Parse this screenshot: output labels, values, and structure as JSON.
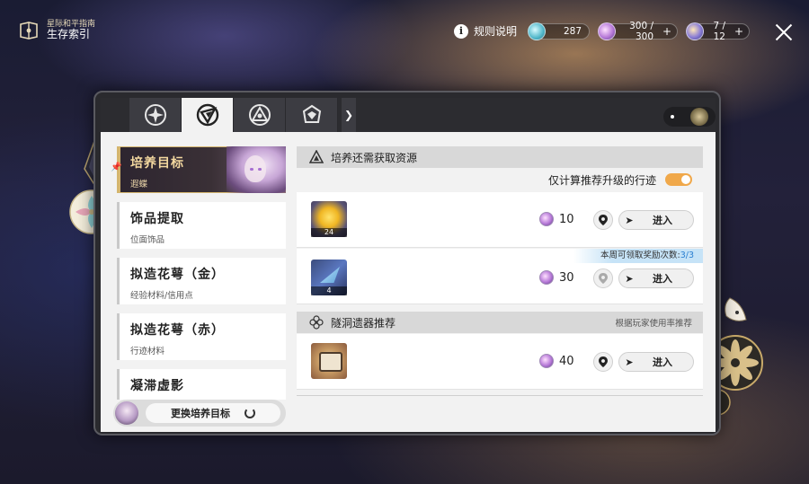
{
  "header": {
    "subtitle": "星际和平指南",
    "title": "生存索引",
    "rules_label": "规则说明",
    "resources": [
      {
        "icon": "crystal-icon",
        "value": "287"
      },
      {
        "icon": "trailblaze-power-icon",
        "value": "300 / 300"
      },
      {
        "icon": "fuel-icon",
        "value": "7 / 12"
      }
    ]
  },
  "tabs": [
    {
      "icon": "star-emblem-tab-icon",
      "active": false
    },
    {
      "icon": "compass-tab-icon",
      "active": true
    },
    {
      "icon": "triangle-emblem-tab-icon",
      "active": false
    },
    {
      "icon": "crown-emblem-tab-icon",
      "active": false
    }
  ],
  "sidebar": {
    "items": [
      {
        "title": "培养目标",
        "sub": "遐蝶",
        "active": true
      },
      {
        "title": "饰品提取",
        "sub": "位面饰品"
      },
      {
        "title": "拟造花萼（金）",
        "sub": "经验材料/信用点"
      },
      {
        "title": "拟造花萼（赤）",
        "sub": "行迹材料"
      },
      {
        "title": "凝滞虚影",
        "sub": ""
      }
    ],
    "switch_label": "更换培养目标"
  },
  "panel": {
    "section1": {
      "title": "培养还需获取资源",
      "toggle_label": "仅计算推荐升级的行迹",
      "toggle_on": true,
      "rows": [
        {
          "count": "24",
          "cost": "10",
          "enter": "进入"
        },
        {
          "count": "4",
          "cost": "30",
          "enter": "进入",
          "weekly_prefix": "本周可领取奖励次数:",
          "weekly_value": "3/3"
        }
      ]
    },
    "section2": {
      "title": "隧洞遗器推荐",
      "note": "根据玩家使用率推荐",
      "rows": [
        {
          "cost": "40",
          "enter": "进入"
        }
      ]
    }
  },
  "colors": {
    "accent": "#f0a84a",
    "gold": "#d4b56e",
    "panel_bg": "#f2f2f2"
  }
}
